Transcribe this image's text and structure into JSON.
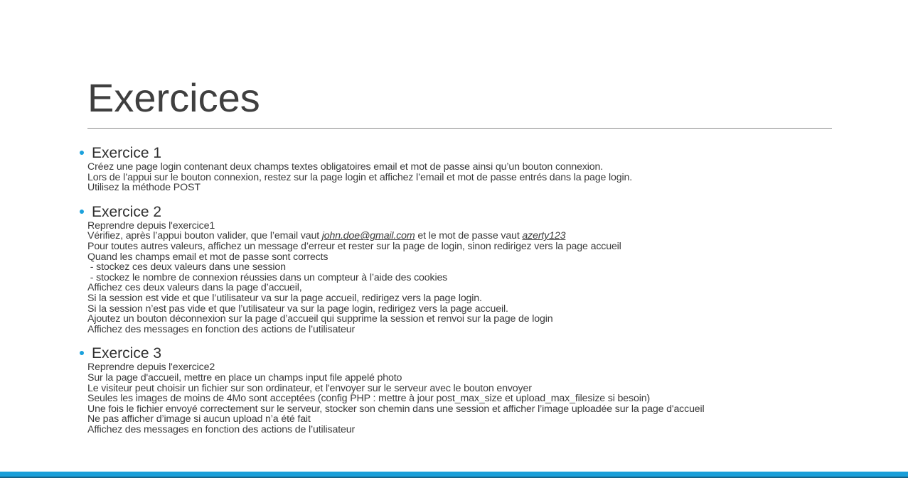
{
  "slide": {
    "title": "Exercices"
  },
  "exercises": [
    {
      "heading": "Exercice 1",
      "lines": [
        "Créez une page login contenant deux champs textes obligatoires email et mot de passe ainsi qu’un bouton connexion.",
        "Lors de l’appui sur le bouton connexion, restez sur la page login et affichez l’email et mot de passe entrés dans la page login.",
        "Utilisez la méthode POST"
      ]
    },
    {
      "heading": "Exercice 2",
      "intro": "Reprendre depuis l'exercice1",
      "verify": {
        "before": "Vérifiez, après l’appui bouton valider, que l’email vaut ",
        "email": "john.doe@gmail.com",
        "middle": " et le mot de passe vaut ",
        "password": "azerty123"
      },
      "lines": [
        "Pour toutes autres valeurs, affichez un message d’erreur et rester sur la page de login, sinon redirigez vers la page accueil",
        "Quand les champs email et mot de passe sont corrects",
        " - stockez ces deux valeurs dans une session",
        " - stockez le nombre de connexion réussies dans un compteur à l’aide des cookies",
        "Affichez ces deux valeurs dans la page d’accueil,",
        "Si la session est vide et que l’utilisateur va sur la page accueil, redirigez vers la page login.",
        "Si la session n’est pas vide et que l’utilisateur va sur la page login, redirigez vers la page accueil.",
        "Ajoutez un bouton déconnexion sur la page d’accueil qui supprime la session et renvoi sur la page de login",
        "Affichez des messages en fonction des actions de l’utilisateur"
      ]
    },
    {
      "heading": "Exercice 3",
      "lines": [
        "Reprendre depuis l'exercice2",
        "Sur la page d'accueil, mettre en place un champs input file appelé photo",
        "Le visiteur peut choisir un fichier sur son ordinateur, et l'envoyer sur le serveur avec le bouton envoyer",
        "Seules les images de moins de 4Mo sont acceptées (config PHP : mettre à jour post_max_size et upload_max_filesize si besoin)",
        "Une fois le fichier envoyé correctement sur le serveur, stocker son chemin dans une session et afficher l’image uploadée sur la page d'accueil",
        "Ne pas afficher d’image si aucun upload n’a été fait",
        "Affichez des messages en fonction des actions de l’utilisateur"
      ]
    }
  ],
  "colors": {
    "accent": "#1a9fd9",
    "bullet": "#1ba1dc",
    "text": "#3a3a3a"
  }
}
